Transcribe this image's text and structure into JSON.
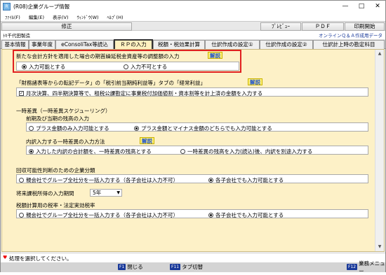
{
  "window": {
    "title": "(R08)企業グループ情報"
  },
  "menu": [
    "ﾌｧｲﾙ(F)",
    "編集(E)",
    "表示(V)",
    "ｳｨﾝﾄﾞｳ(W)",
    "ﾍﾙﾌﾟ(H)"
  ],
  "toolbar": {
    "fix": "修正",
    "preview": "ﾌﾟﾚﾋﾞｭｰ",
    "pdf": "ＰＤＦ",
    "print": "印刷開始"
  },
  "info": {
    "company": "ﾄｷ千代田製造",
    "qa": "オンラインＱ＆Ａ作成用データ"
  },
  "tabs": [
    "基本情報",
    "事業年度",
    "eConsoliTax等読込",
    "ＲＰの入力",
    "税額・税効果計算",
    "仕訳作成の設定①",
    "仕訳作成の設定②",
    "仕訳計上時の勘定科目"
  ],
  "sec1": {
    "title": "新たな会計方針を適用した場合の期首繰延税金資産等の調整額の入力",
    "help": "解説",
    "opt_yes": "入力可能とする",
    "opt_no": "入力不可とする"
  },
  "sec2": {
    "title": "「財務諸表等からの転記データ」の「税引前当期純利益等」タブの「経常利益」",
    "help": "解説",
    "check": "月次決算、四半期決算等で、租税公課勘定に事業税付加価値割・資本割等を計上済の金額を入力する"
  },
  "sec3": {
    "title": "一時差異（一時差異スケジューリング）",
    "sub1": "前期及び当期の残高の入力",
    "sub1_a": "プラス金額のみ入力可能とする",
    "sub1_b": "プラス金額とマイナス金額のどちらでも入力可能とする",
    "sub2": "内訳入力する一時差異の入力方法",
    "help": "解説",
    "sub2_a": "入力した内訳の合計額を、一時差異の残高とする",
    "sub2_b": "一時差異の残高を入力(読込)後、内訳を別途入力する"
  },
  "sec4": {
    "title": "回収可能性判断のための企業分類",
    "opt_a": "親会社でグループ全社分を一括入力する（各子会社は入力不可）",
    "opt_b": "各子会社でも入力可能とする"
  },
  "sec5": {
    "label": "将来課税所得の入力期間",
    "value": "5年"
  },
  "sec6": {
    "title": "税額計算用の税率・法定実効税率",
    "opt_a": "親会社でグループ全社分を一括入力する（各子会社は入力不可）",
    "opt_b": "各子会社でも入力可能とする"
  },
  "status": {
    "text": "処理を選択してください。"
  },
  "fkeys": {
    "f1k": "F1",
    "close": "閉じる",
    "f11k": "F11",
    "tab": "タブ切替",
    "f12k": "F12",
    "menu": "業務メニュー"
  }
}
